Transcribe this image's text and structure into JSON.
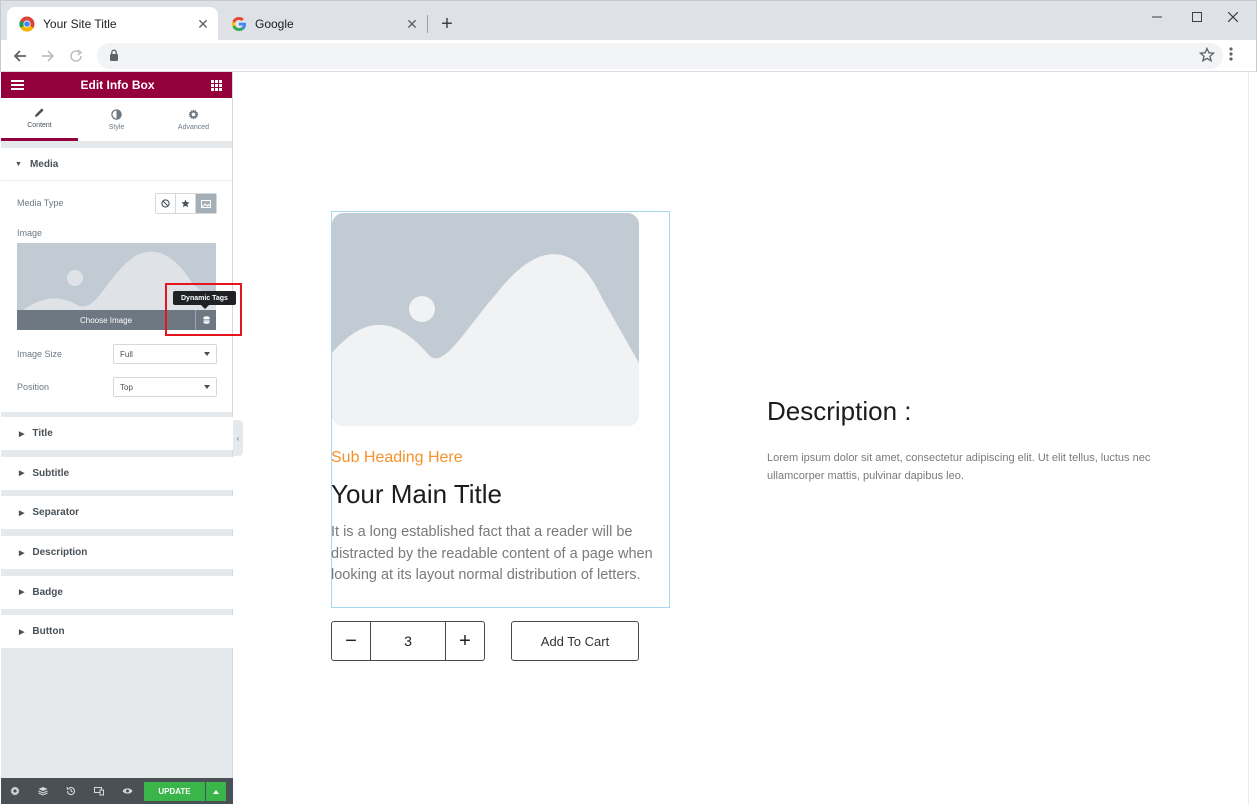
{
  "browser": {
    "tabs": [
      {
        "title": "Your Site Title",
        "active": true
      },
      {
        "title": "Google",
        "active": false
      }
    ],
    "close_glyph": "✕",
    "new_tab_glyph": "+"
  },
  "panel": {
    "header_title": "Edit Info Box",
    "tabs": [
      {
        "label": "Content",
        "icon": "pencil-icon"
      },
      {
        "label": "Style",
        "icon": "half-circle-icon"
      },
      {
        "label": "Advanced",
        "icon": "gear-icon"
      }
    ],
    "media": {
      "section_title": "Media",
      "media_type_label": "Media Type",
      "image_label": "Image",
      "choose_image": "Choose Image",
      "dynamic_tags_tooltip": "Dynamic Tags",
      "image_size_label": "Image Size",
      "image_size_value": "Full",
      "position_label": "Position",
      "position_value": "Top"
    },
    "sections": [
      "Title",
      "Subtitle",
      "Separator",
      "Description",
      "Badge",
      "Button"
    ],
    "footer": {
      "update_label": "UPDATE"
    }
  },
  "preview": {
    "sub_heading": "Sub Heading Here",
    "main_title": "Your Main Title",
    "main_description": "It is a long established fact that a reader will be distracted by the readable content of a page when looking at its layout normal distribution of letters.",
    "quantity": "3",
    "minus": "−",
    "plus": "+",
    "add_to_cart": "Add To Cart",
    "description_heading": "Description :",
    "description_text": "Lorem ipsum dolor sit amet, consectetur adipiscing elit. Ut elit tellus, luctus nec ullamcorper mattis, pulvinar dapibus leo."
  },
  "colors": {
    "panel_accent": "#93003c",
    "update_green": "#39b54a",
    "sub_heading_orange": "#f5922a",
    "highlight_red": "#e4151e"
  }
}
